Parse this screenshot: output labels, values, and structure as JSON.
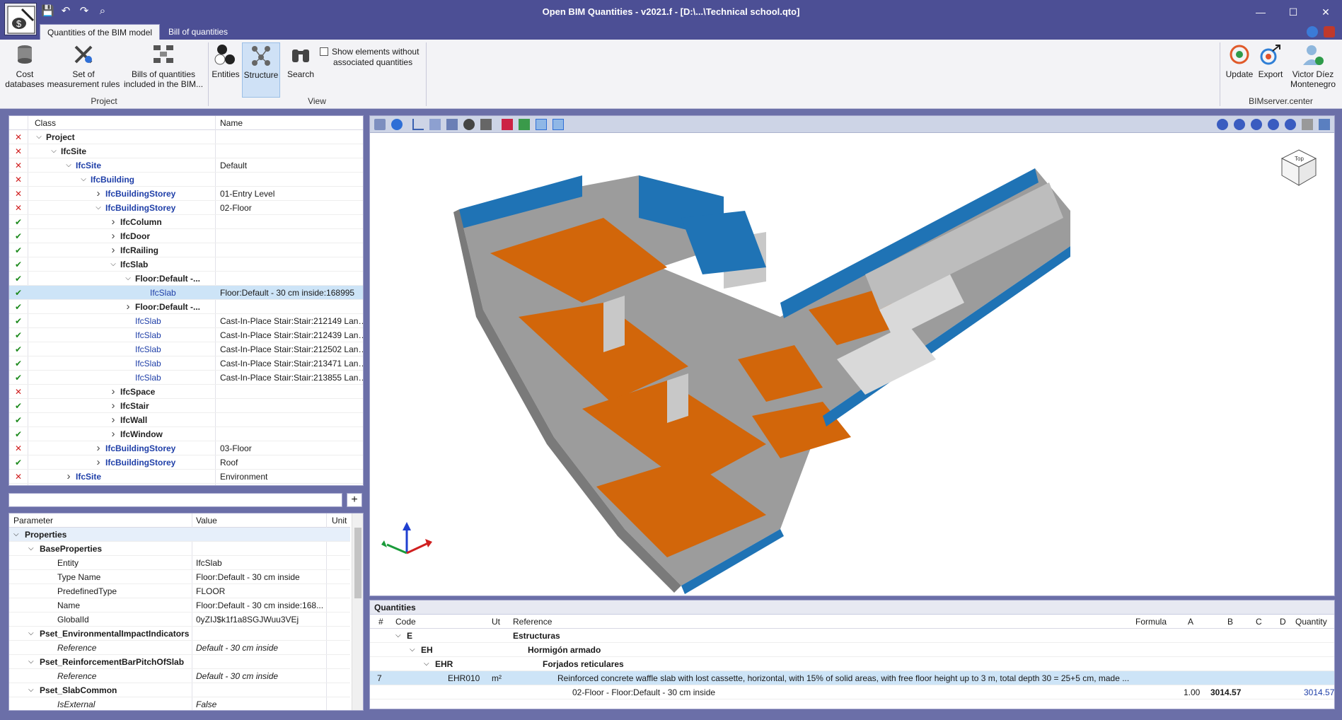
{
  "window": {
    "title": "Open BIM Quantities - v2021.f - [D:\\...\\Technical school.qto]",
    "controls": [
      "—",
      "☐",
      "✕"
    ]
  },
  "tabs": [
    {
      "label": "Quantities of the BIM model",
      "active": true
    },
    {
      "label": "Bill of quantities",
      "active": false
    }
  ],
  "ribbon": {
    "project": {
      "label": "Project",
      "buttons": [
        {
          "line1": "Cost",
          "line2": "databases"
        },
        {
          "line1": "Set of",
          "line2": "measurement rules"
        },
        {
          "line1": "Bills of quantities",
          "line2": "included in the BIM..."
        }
      ]
    },
    "view": {
      "label": "View",
      "buttons": [
        {
          "line1": "Entities",
          "line2": ""
        },
        {
          "line1": "Structure",
          "line2": ""
        },
        {
          "line1": "Search",
          "line2": ""
        }
      ],
      "checkbox_line1": "Show elements without",
      "checkbox_line2": "associated quantities"
    },
    "bimserver": {
      "label": "BIMserver.center",
      "buttons": [
        {
          "line1": "Update",
          "line2": ""
        },
        {
          "line1": "Export",
          "line2": ""
        },
        {
          "line1": "Victor Díez",
          "line2": "Montenegro"
        }
      ]
    }
  },
  "tree": {
    "col_class": "Class",
    "col_name": "Name",
    "rows": [
      {
        "mark": "x",
        "level": 0,
        "chev": "v",
        "cls": "Project",
        "style": "bold",
        "name": ""
      },
      {
        "mark": "x",
        "level": 1,
        "chev": "v",
        "cls": "IfcSite",
        "style": "bold",
        "name": ""
      },
      {
        "mark": "x",
        "level": 2,
        "chev": "v",
        "cls": "IfcSite",
        "style": "blue",
        "name": "Default"
      },
      {
        "mark": "x",
        "level": 3,
        "chev": "v",
        "cls": "IfcBuilding",
        "style": "blue",
        "name": ""
      },
      {
        "mark": "x",
        "level": 4,
        "chev": ">",
        "cls": "IfcBuildingStorey",
        "style": "blue",
        "name": "01-Entry Level"
      },
      {
        "mark": "x",
        "level": 4,
        "chev": "v",
        "cls": "IfcBuildingStorey",
        "style": "blue",
        "name": "02-Floor"
      },
      {
        "mark": "ok",
        "level": 5,
        "chev": ">",
        "cls": "IfcColumn",
        "style": "bold",
        "name": ""
      },
      {
        "mark": "ok",
        "level": 5,
        "chev": ">",
        "cls": "IfcDoor",
        "style": "bold",
        "name": ""
      },
      {
        "mark": "ok",
        "level": 5,
        "chev": ">",
        "cls": "IfcRailing",
        "style": "bold",
        "name": ""
      },
      {
        "mark": "ok",
        "level": 5,
        "chev": "v",
        "cls": "IfcSlab",
        "style": "bold",
        "name": ""
      },
      {
        "mark": "ok",
        "level": 6,
        "chev": "v",
        "cls": "Floor:Default -...",
        "style": "bold",
        "name": ""
      },
      {
        "mark": "ok",
        "level": 7,
        "chev": "",
        "cls": "IfcSlab",
        "style": "plain",
        "name": "Floor:Default - 30 cm inside:168995",
        "sel": true
      },
      {
        "mark": "ok",
        "level": 6,
        "chev": ">",
        "cls": "Floor:Default -...",
        "style": "bold",
        "name": ""
      },
      {
        "mark": "ok",
        "level": 6,
        "chev": "",
        "cls": "IfcSlab",
        "style": "plain",
        "name": "Cast-In-Place Stair:Stair:212149 Landi..."
      },
      {
        "mark": "ok",
        "level": 6,
        "chev": "",
        "cls": "IfcSlab",
        "style": "plain",
        "name": "Cast-In-Place Stair:Stair:212439 Landi..."
      },
      {
        "mark": "ok",
        "level": 6,
        "chev": "",
        "cls": "IfcSlab",
        "style": "plain",
        "name": "Cast-In-Place Stair:Stair:212502 Landi..."
      },
      {
        "mark": "ok",
        "level": 6,
        "chev": "",
        "cls": "IfcSlab",
        "style": "plain",
        "name": "Cast-In-Place Stair:Stair:213471 Landi..."
      },
      {
        "mark": "ok",
        "level": 6,
        "chev": "",
        "cls": "IfcSlab",
        "style": "plain",
        "name": "Cast-In-Place Stair:Stair:213855 Landi..."
      },
      {
        "mark": "x",
        "level": 5,
        "chev": ">",
        "cls": "IfcSpace",
        "style": "bold",
        "name": ""
      },
      {
        "mark": "ok",
        "level": 5,
        "chev": ">",
        "cls": "IfcStair",
        "style": "bold",
        "name": ""
      },
      {
        "mark": "ok",
        "level": 5,
        "chev": ">",
        "cls": "IfcWall",
        "style": "bold",
        "name": ""
      },
      {
        "mark": "ok",
        "level": 5,
        "chev": ">",
        "cls": "IfcWindow",
        "style": "bold",
        "name": ""
      },
      {
        "mark": "x",
        "level": 4,
        "chev": ">",
        "cls": "IfcBuildingStorey",
        "style": "blue",
        "name": "03-Floor"
      },
      {
        "mark": "ok",
        "level": 4,
        "chev": ">",
        "cls": "IfcBuildingStorey",
        "style": "blue",
        "name": "Roof"
      },
      {
        "mark": "x",
        "level": 2,
        "chev": ">",
        "cls": "IfcSite",
        "style": "blue",
        "name": "Environment"
      }
    ]
  },
  "props": {
    "col_param": "Parameter",
    "col_value": "Value",
    "col_unit": "Unit",
    "rows": [
      {
        "level": 0,
        "param": "Properties",
        "value": "",
        "group": true,
        "chev": "v"
      },
      {
        "level": 1,
        "param": "BaseProperties",
        "value": "",
        "bold": true,
        "chev": "v"
      },
      {
        "level": 2,
        "param": "Entity",
        "value": "IfcSlab"
      },
      {
        "level": 2,
        "param": "Type Name",
        "value": "Floor:Default - 30 cm inside"
      },
      {
        "level": 2,
        "param": "PredefinedType",
        "value": "FLOOR"
      },
      {
        "level": 2,
        "param": "Name",
        "value": "Floor:Default - 30 cm inside:168..."
      },
      {
        "level": 2,
        "param": "GlobalId",
        "value": "0yZIJ$k1f1a8SGJWuu3VEj"
      },
      {
        "level": 1,
        "param": "Pset_EnvironmentalImpactIndicators",
        "value": "",
        "bold": true,
        "chev": "v"
      },
      {
        "level": 2,
        "param": "Reference",
        "value": "Default - 30 cm inside",
        "italic": true
      },
      {
        "level": 1,
        "param": "Pset_ReinforcementBarPitchOfSlab",
        "value": "",
        "bold": true,
        "chev": "v"
      },
      {
        "level": 2,
        "param": "Reference",
        "value": "Default - 30 cm inside",
        "italic": true
      },
      {
        "level": 1,
        "param": "Pset_SlabCommon",
        "value": "",
        "bold": true,
        "chev": "v"
      },
      {
        "level": 2,
        "param": "IsExternal",
        "value": "False",
        "italic": true
      }
    ]
  },
  "quantities": {
    "title": "Quantities",
    "headers": {
      "num": "#",
      "code": "Code",
      "ut": "Ut",
      "ref": "Reference",
      "formula": "Formula",
      "a": "A",
      "b": "B",
      "c": "C",
      "d": "D",
      "qty": "Quantity"
    },
    "rows": [
      {
        "num": "",
        "code": "E",
        "codeLevel": 0,
        "chev": "v",
        "ut": "",
        "ref": "Estructuras",
        "refBold": true,
        "refLevel": 0
      },
      {
        "num": "",
        "code": "EH",
        "codeLevel": 1,
        "chev": "v",
        "ut": "",
        "ref": "Hormigón armado",
        "refBold": true,
        "refLevel": 1
      },
      {
        "num": "",
        "code": "EHR",
        "codeLevel": 2,
        "chev": "v",
        "ut": "",
        "ref": "Forjados reticulares",
        "refBold": true,
        "refLevel": 2
      },
      {
        "num": "7",
        "code": "EHR010",
        "codeLevel": 3,
        "chev": "",
        "ut": "m²",
        "ref": "Reinforced concrete waffle slab with lost cassette, horizontal, with 15% of solid areas, with free floor height up to 3 m, total depth 30 = 25+5 cm, made ...",
        "refLevel": 3,
        "sel": true
      },
      {
        "num": "",
        "code": "",
        "codeLevel": 0,
        "chev": "",
        "ut": "",
        "ref": "02-Floor - Floor:Default - 30 cm inside",
        "refLevel": 4,
        "a": "1.00",
        "b": "3014.57",
        "qty": "3014.57"
      }
    ]
  },
  "viewer": {
    "navcube": "Top",
    "colors": {
      "floor": "#d2660a",
      "glass": "#1f73b5",
      "wall": "#b4b4b4"
    }
  }
}
